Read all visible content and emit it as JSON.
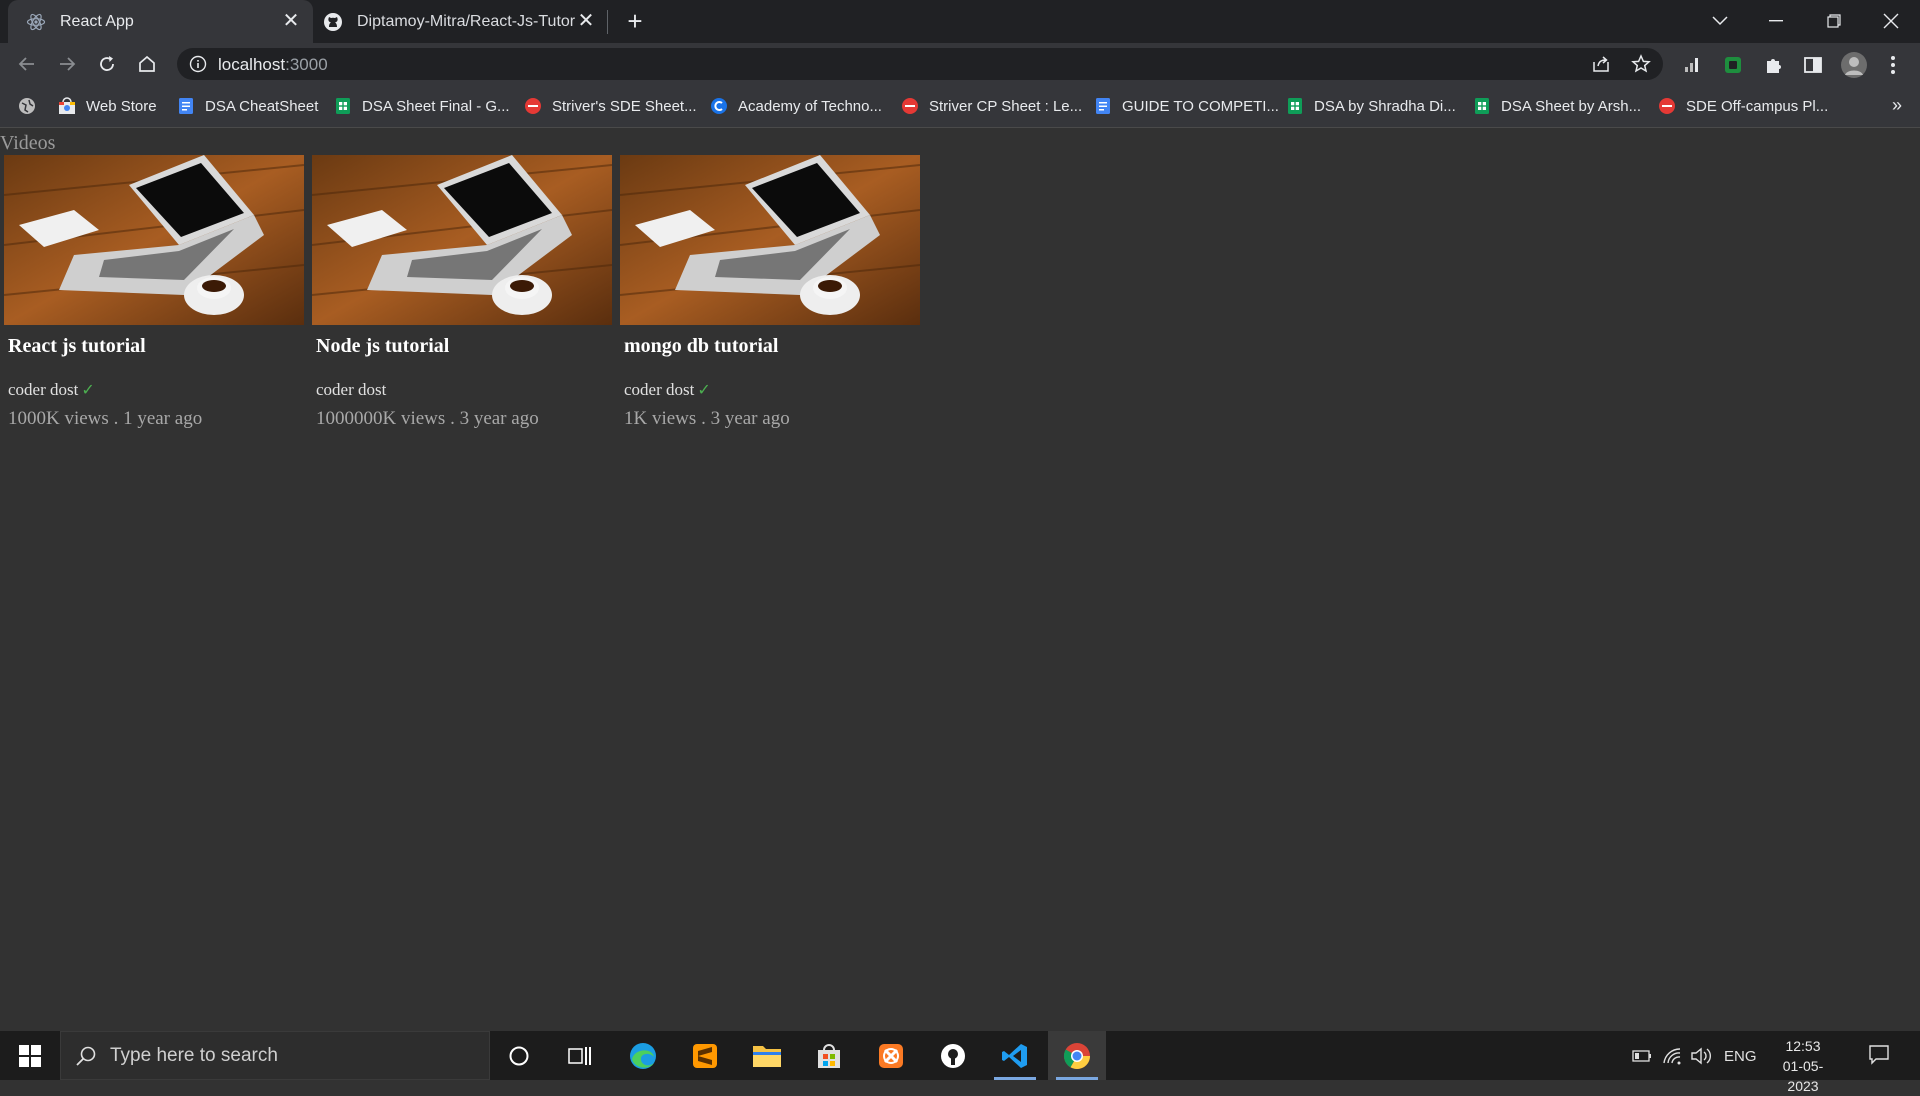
{
  "browser": {
    "tabs": [
      {
        "title": "React App",
        "icon": "react-icon",
        "active": true
      },
      {
        "title": "Diptamoy-Mitra/React-Js-Tutorial",
        "icon": "github-icon",
        "active": false
      }
    ],
    "url": {
      "host": "localhost",
      "port": ":3000"
    },
    "bookmarks": [
      {
        "label": "Web Store",
        "icon": "webstore-icon"
      },
      {
        "label": "DSA CheatSheet",
        "icon": "docs-icon"
      },
      {
        "label": "DSA Sheet Final - G...",
        "icon": "sheets-icon"
      },
      {
        "label": "Striver's SDE Sheet...",
        "icon": "tuf-icon"
      },
      {
        "label": "Academy of Techno...",
        "icon": "c-icon"
      },
      {
        "label": "Striver CP Sheet : Le...",
        "icon": "tuf-icon"
      },
      {
        "label": "GUIDE TO COMPETI...",
        "icon": "docs-icon"
      },
      {
        "label": "DSA by Shradha Di...",
        "icon": "sheets-icon"
      },
      {
        "label": "DSA Sheet by Arsh...",
        "icon": "sheets-icon"
      },
      {
        "label": "SDE Off-campus Pl...",
        "icon": "tuf-icon"
      }
    ],
    "bookmarks_more": "»"
  },
  "page": {
    "section_title": "Videos",
    "videos": [
      {
        "title": "React js tutorial",
        "channel": "coder dost",
        "verified": true,
        "views": "1000K views",
        "sep": " . ",
        "time": "1 year ago"
      },
      {
        "title": "Node js tutorial",
        "channel": "coder dost",
        "verified": false,
        "views": "1000000K views",
        "sep": " . ",
        "time": "3 year ago"
      },
      {
        "title": "mongo db tutorial",
        "channel": "coder dost",
        "verified": true,
        "views": "1K views",
        "sep": " . ",
        "time": "3 year ago"
      }
    ]
  },
  "taskbar": {
    "search_placeholder": "Type here to search",
    "language": "ENG",
    "time": "12:53",
    "date": "01-05-2023"
  },
  "colors": {
    "page_bg": "#323232",
    "chrome_dark": "#202124",
    "chrome_toolbar": "#35363a",
    "verified_green": "#4caf50"
  }
}
